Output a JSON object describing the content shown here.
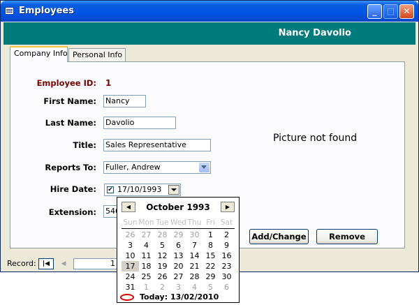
{
  "window": {
    "title": "Employees"
  },
  "header": {
    "name": "Nancy Davolio",
    "band_color": "#007b7b"
  },
  "tabs": [
    {
      "label": "Company Info",
      "active": true
    },
    {
      "label": "Personal Info",
      "active": false
    }
  ],
  "form": {
    "employee_id": {
      "label": "Employee ID:",
      "value": "1"
    },
    "first_name": {
      "label": "First Name:",
      "value": "Nancy"
    },
    "last_name": {
      "label": "Last Name:",
      "value": "Davolio"
    },
    "title": {
      "label": "Title:",
      "value": "Sales Representative"
    },
    "reports_to": {
      "label": "Reports To:",
      "value": "Fuller, Andrew"
    },
    "hire_date": {
      "label": "Hire Date:",
      "value": "17/10/1993",
      "checked": true
    },
    "extension": {
      "label": "Extension:",
      "value": "546"
    }
  },
  "picture": {
    "text": "Picture not found"
  },
  "buttons": {
    "add_change": "Add/Change",
    "remove": "Remove"
  },
  "record_nav": {
    "label": "Record:",
    "current": "1"
  },
  "calendar": {
    "month_year": "October 1993",
    "days_of_week": [
      "Sun",
      "Mon",
      "Tue",
      "Wed",
      "Thu",
      "Fri",
      "Sat"
    ],
    "weeks": [
      [
        "26",
        "27",
        "28",
        "29",
        "30",
        "1",
        "2"
      ],
      [
        "3",
        "4",
        "5",
        "6",
        "7",
        "8",
        "9"
      ],
      [
        "10",
        "11",
        "12",
        "13",
        "14",
        "15",
        "16"
      ],
      [
        "17",
        "18",
        "19",
        "20",
        "21",
        "22",
        "23"
      ],
      [
        "24",
        "25",
        "26",
        "27",
        "28",
        "29",
        "30"
      ],
      [
        "31",
        "1",
        "2",
        "3",
        "4",
        "5",
        "6"
      ]
    ],
    "selected": "17",
    "today_label": "Today: 13/02/2010"
  }
}
